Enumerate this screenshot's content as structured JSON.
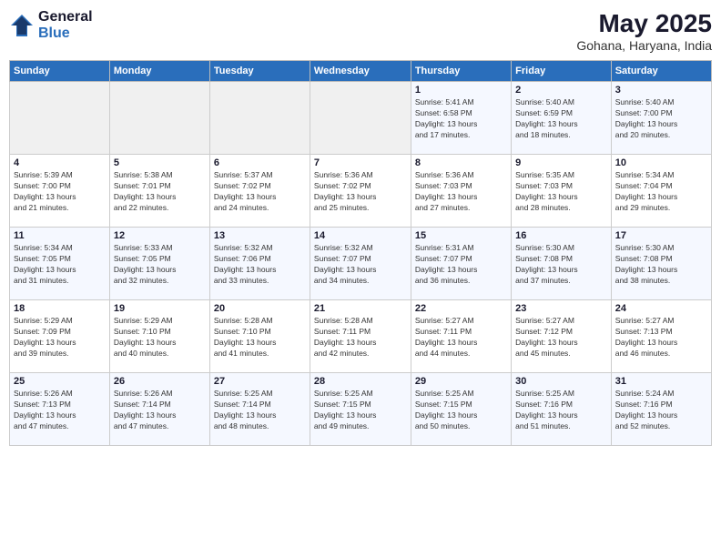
{
  "header": {
    "logo_general": "General",
    "logo_blue": "Blue",
    "month_title": "May 2025",
    "location": "Gohana, Haryana, India"
  },
  "days_of_week": [
    "Sunday",
    "Monday",
    "Tuesday",
    "Wednesday",
    "Thursday",
    "Friday",
    "Saturday"
  ],
  "weeks": [
    [
      {
        "day": "",
        "info": ""
      },
      {
        "day": "",
        "info": ""
      },
      {
        "day": "",
        "info": ""
      },
      {
        "day": "",
        "info": ""
      },
      {
        "day": "1",
        "info": "Sunrise: 5:41 AM\nSunset: 6:58 PM\nDaylight: 13 hours\nand 17 minutes."
      },
      {
        "day": "2",
        "info": "Sunrise: 5:40 AM\nSunset: 6:59 PM\nDaylight: 13 hours\nand 18 minutes."
      },
      {
        "day": "3",
        "info": "Sunrise: 5:40 AM\nSunset: 7:00 PM\nDaylight: 13 hours\nand 20 minutes."
      }
    ],
    [
      {
        "day": "4",
        "info": "Sunrise: 5:39 AM\nSunset: 7:00 PM\nDaylight: 13 hours\nand 21 minutes."
      },
      {
        "day": "5",
        "info": "Sunrise: 5:38 AM\nSunset: 7:01 PM\nDaylight: 13 hours\nand 22 minutes."
      },
      {
        "day": "6",
        "info": "Sunrise: 5:37 AM\nSunset: 7:02 PM\nDaylight: 13 hours\nand 24 minutes."
      },
      {
        "day": "7",
        "info": "Sunrise: 5:36 AM\nSunset: 7:02 PM\nDaylight: 13 hours\nand 25 minutes."
      },
      {
        "day": "8",
        "info": "Sunrise: 5:36 AM\nSunset: 7:03 PM\nDaylight: 13 hours\nand 27 minutes."
      },
      {
        "day": "9",
        "info": "Sunrise: 5:35 AM\nSunset: 7:03 PM\nDaylight: 13 hours\nand 28 minutes."
      },
      {
        "day": "10",
        "info": "Sunrise: 5:34 AM\nSunset: 7:04 PM\nDaylight: 13 hours\nand 29 minutes."
      }
    ],
    [
      {
        "day": "11",
        "info": "Sunrise: 5:34 AM\nSunset: 7:05 PM\nDaylight: 13 hours\nand 31 minutes."
      },
      {
        "day": "12",
        "info": "Sunrise: 5:33 AM\nSunset: 7:05 PM\nDaylight: 13 hours\nand 32 minutes."
      },
      {
        "day": "13",
        "info": "Sunrise: 5:32 AM\nSunset: 7:06 PM\nDaylight: 13 hours\nand 33 minutes."
      },
      {
        "day": "14",
        "info": "Sunrise: 5:32 AM\nSunset: 7:07 PM\nDaylight: 13 hours\nand 34 minutes."
      },
      {
        "day": "15",
        "info": "Sunrise: 5:31 AM\nSunset: 7:07 PM\nDaylight: 13 hours\nand 36 minutes."
      },
      {
        "day": "16",
        "info": "Sunrise: 5:30 AM\nSunset: 7:08 PM\nDaylight: 13 hours\nand 37 minutes."
      },
      {
        "day": "17",
        "info": "Sunrise: 5:30 AM\nSunset: 7:08 PM\nDaylight: 13 hours\nand 38 minutes."
      }
    ],
    [
      {
        "day": "18",
        "info": "Sunrise: 5:29 AM\nSunset: 7:09 PM\nDaylight: 13 hours\nand 39 minutes."
      },
      {
        "day": "19",
        "info": "Sunrise: 5:29 AM\nSunset: 7:10 PM\nDaylight: 13 hours\nand 40 minutes."
      },
      {
        "day": "20",
        "info": "Sunrise: 5:28 AM\nSunset: 7:10 PM\nDaylight: 13 hours\nand 41 minutes."
      },
      {
        "day": "21",
        "info": "Sunrise: 5:28 AM\nSunset: 7:11 PM\nDaylight: 13 hours\nand 42 minutes."
      },
      {
        "day": "22",
        "info": "Sunrise: 5:27 AM\nSunset: 7:11 PM\nDaylight: 13 hours\nand 44 minutes."
      },
      {
        "day": "23",
        "info": "Sunrise: 5:27 AM\nSunset: 7:12 PM\nDaylight: 13 hours\nand 45 minutes."
      },
      {
        "day": "24",
        "info": "Sunrise: 5:27 AM\nSunset: 7:13 PM\nDaylight: 13 hours\nand 46 minutes."
      }
    ],
    [
      {
        "day": "25",
        "info": "Sunrise: 5:26 AM\nSunset: 7:13 PM\nDaylight: 13 hours\nand 47 minutes."
      },
      {
        "day": "26",
        "info": "Sunrise: 5:26 AM\nSunset: 7:14 PM\nDaylight: 13 hours\nand 47 minutes."
      },
      {
        "day": "27",
        "info": "Sunrise: 5:25 AM\nSunset: 7:14 PM\nDaylight: 13 hours\nand 48 minutes."
      },
      {
        "day": "28",
        "info": "Sunrise: 5:25 AM\nSunset: 7:15 PM\nDaylight: 13 hours\nand 49 minutes."
      },
      {
        "day": "29",
        "info": "Sunrise: 5:25 AM\nSunset: 7:15 PM\nDaylight: 13 hours\nand 50 minutes."
      },
      {
        "day": "30",
        "info": "Sunrise: 5:25 AM\nSunset: 7:16 PM\nDaylight: 13 hours\nand 51 minutes."
      },
      {
        "day": "31",
        "info": "Sunrise: 5:24 AM\nSunset: 7:16 PM\nDaylight: 13 hours\nand 52 minutes."
      }
    ]
  ]
}
